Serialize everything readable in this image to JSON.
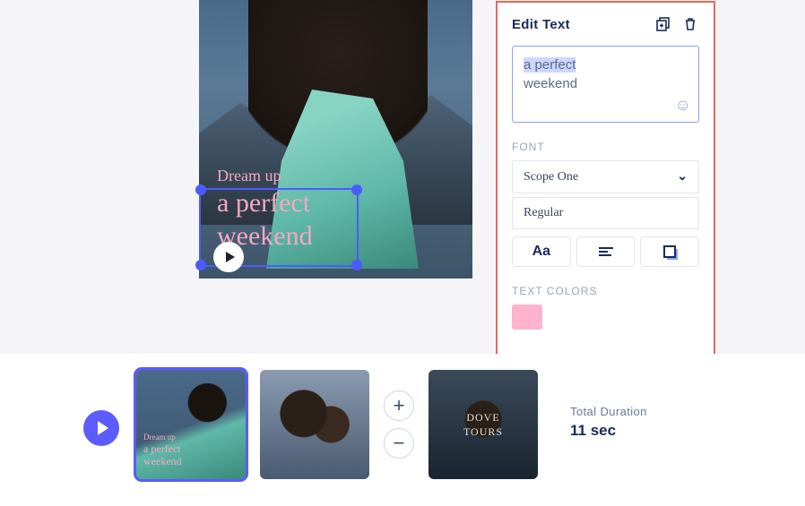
{
  "panel": {
    "title": "Edit Text",
    "text_value": "a perfect weekend",
    "text_line1": "a perfect",
    "text_line2": "weekend",
    "font_label": "FONT",
    "font_family": "Scope One",
    "font_weight": "Regular",
    "case_button": "Aa",
    "colors_label": "TEXT COLORS",
    "color_swatch": "#ffb3cd"
  },
  "canvas": {
    "line1": "Dream up",
    "line2": "a perfect",
    "line3": "weekend"
  },
  "thumbs": {
    "t1_line1": "Dream up",
    "t1_line2": "a perfect",
    "t1_line3": "weekend",
    "t3_line1": "DOVE",
    "t3_line2": "TOURS"
  },
  "duration": {
    "label": "Total Duration",
    "value": "11 sec"
  },
  "icons": {
    "plus": "+",
    "minus": "−",
    "emoji": "☺",
    "chev": "⌄"
  }
}
